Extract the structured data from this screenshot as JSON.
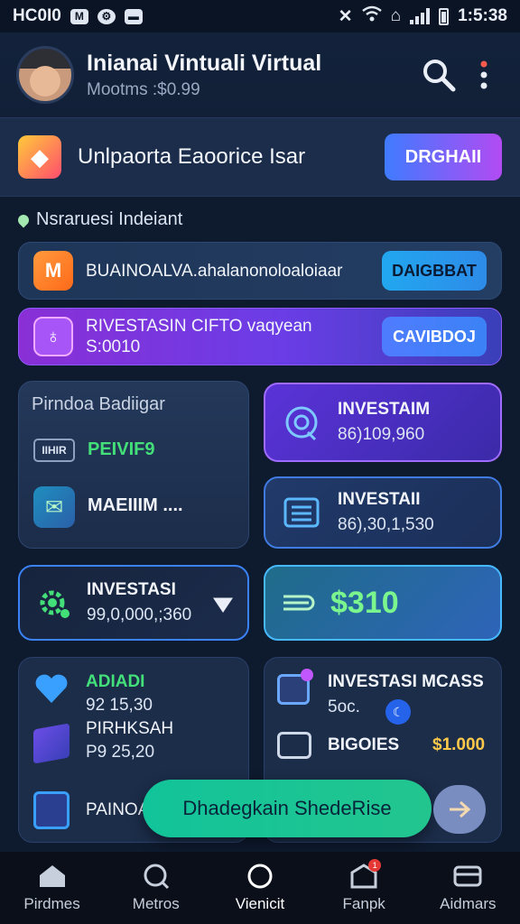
{
  "status_bar": {
    "carrier": "HC0I0",
    "time": "1:5:38"
  },
  "header": {
    "title": "Inianai Vintuali Virtual",
    "subtitle": "Mootms :$0.99"
  },
  "banner": {
    "title": "Unlpaorta Eaoorice Isar",
    "button": "DRGHAII"
  },
  "section": {
    "label": "Nsraruesi Indeiant"
  },
  "rows": [
    {
      "title": "BUAINOALVA.ahalanonoloaloiaar",
      "button": "DAIGBBAT",
      "icon": "m-logo-icon"
    },
    {
      "title": "RIVESTASIN CIFTO vaqyean",
      "value": "S:0010",
      "button": "CAVIBDOJ",
      "icon": "gift-icon"
    }
  ],
  "left_card": {
    "title": "Pirndoa Badiigar",
    "chip": "IIHIR",
    "green": "PEIVIF9",
    "item": "MAEIIIM ...."
  },
  "invest_cards": [
    {
      "title": "INVESTAIM",
      "value": "86)109,960"
    },
    {
      "title": "INVESTAII",
      "value": "86),30,1,530"
    },
    {
      "title": "INVESTASI",
      "value": "99,0,000,;360"
    }
  ],
  "total_card": {
    "value": "$310"
  },
  "bottom_left": {
    "name1": "ADIADI",
    "val1": "92 15,30",
    "name2": "PIRHKSAH",
    "val2": "P9 25,20",
    "name3": "PAINOA"
  },
  "bottom_right": {
    "title": "INVESTASI MCASS",
    "sub": "5oc.",
    "label": "BIGOIES",
    "amount": "$1.000"
  },
  "cta": {
    "label": "Dhadegkain ShedeRise"
  },
  "nav": [
    {
      "label": "Pirdmes",
      "icon": "home-icon"
    },
    {
      "label": "Metros",
      "icon": "chart-icon"
    },
    {
      "label": "Vienicit",
      "icon": "circle-icon"
    },
    {
      "label": "Fanpk",
      "icon": "bag-icon",
      "badge": "1"
    },
    {
      "label": "Aidmars",
      "icon": "card-icon"
    }
  ]
}
